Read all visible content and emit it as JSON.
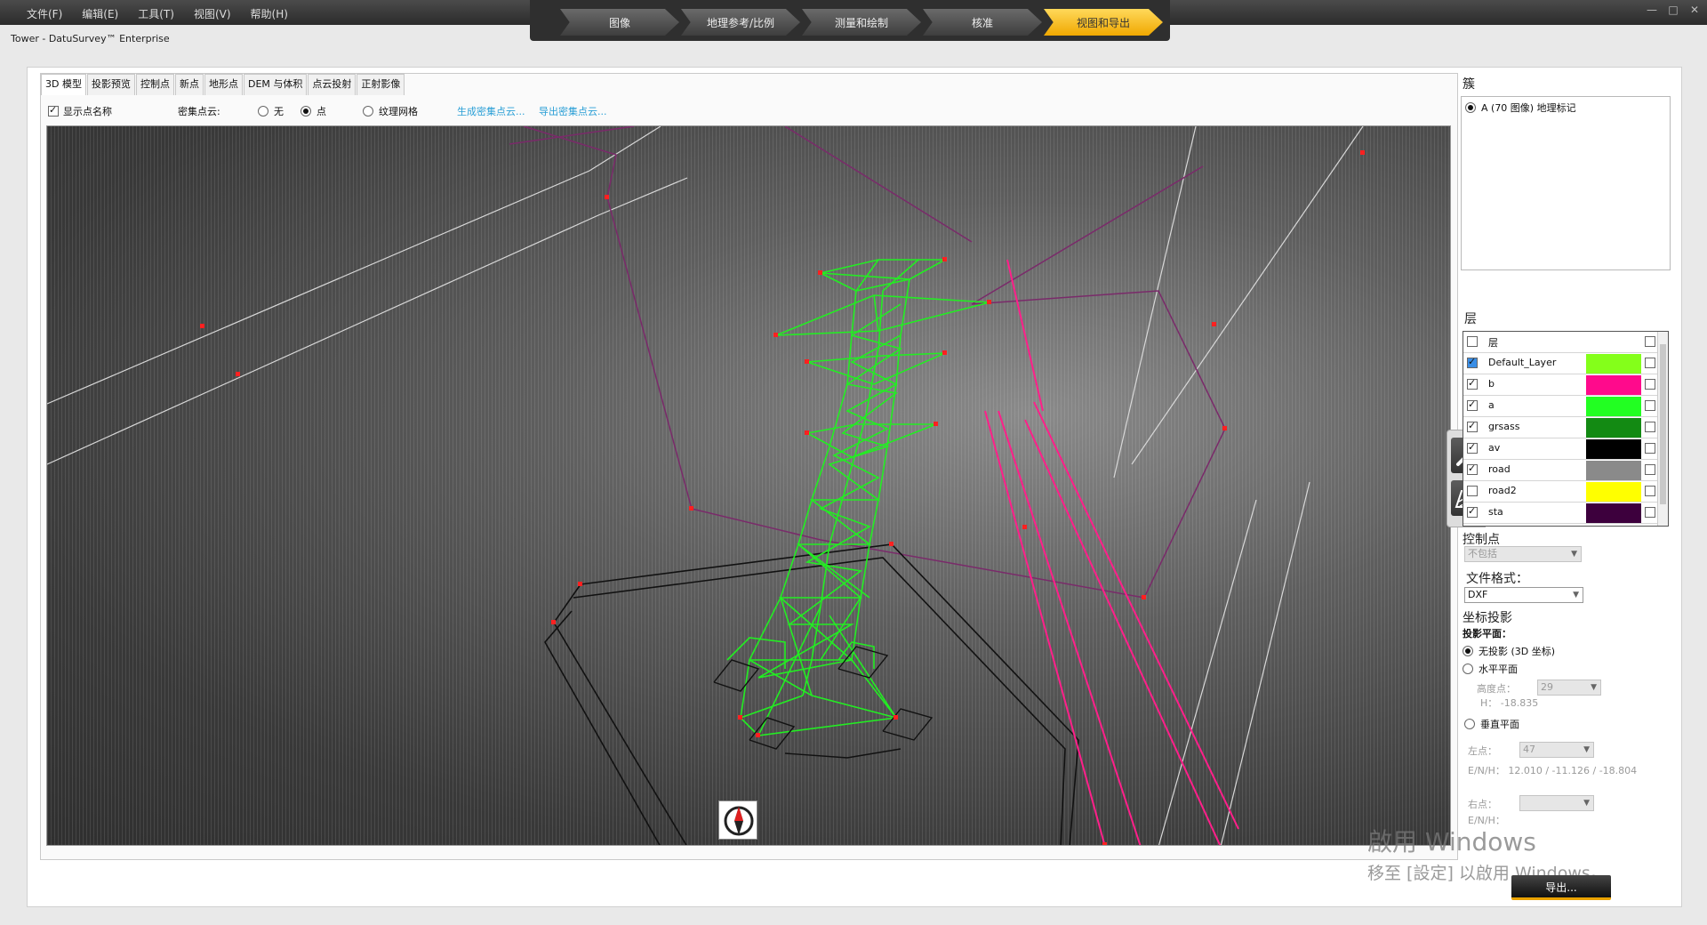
{
  "menu": [
    "文件(F)",
    "编辑(E)",
    "工具(T)",
    "视图(V)",
    "帮助(H)"
  ],
  "window_controls": [
    "—",
    "□",
    "✕"
  ],
  "app_title": "Tower - DatuSurvey™ Enterprise",
  "workflow_steps": [
    {
      "label": "图像",
      "active": false
    },
    {
      "label": "地理参考/比例",
      "active": false
    },
    {
      "label": "测量和绘制",
      "active": false
    },
    {
      "label": "核准",
      "active": false
    },
    {
      "label": "视图和导出",
      "active": true
    }
  ],
  "tabs": [
    "3D 模型",
    "投影预览",
    "控制点",
    "新点",
    "地形点",
    "DEM 与体积",
    "点云投射",
    "正射影像"
  ],
  "active_tab": 0,
  "options": {
    "show_point_names_label": "显示点名称",
    "show_point_names_checked": true,
    "dense_cloud_label": "密集点云:",
    "radio_none": "无",
    "radio_points": "点",
    "radio_texture": "纹理网格",
    "selected_mode": "点",
    "link_generate": "生成密集点云...",
    "link_export": "导出密集点云..."
  },
  "colors": {
    "tower": "#22ee22",
    "vertex": "#ff2020",
    "power_line": "#ff1f8a",
    "boundary": "#7a2a6a",
    "accent": "#f0a800"
  },
  "right": {
    "cluster_title": "簇",
    "cluster_item": "A (70 图像) 地理标记",
    "layers_title": "层",
    "layers_header": "层",
    "layers": [
      {
        "name": "Default_Layer",
        "checked": true,
        "color": "#84ff1a",
        "selected": true
      },
      {
        "name": "b",
        "checked": true,
        "color": "#ff0a8c",
        "selected": false
      },
      {
        "name": "a",
        "checked": true,
        "color": "#22ff22",
        "selected": false
      },
      {
        "name": "grsass",
        "checked": true,
        "color": "#138a13",
        "selected": false
      },
      {
        "name": "av",
        "checked": true,
        "color": "#000000",
        "selected": false
      },
      {
        "name": "road",
        "checked": true,
        "color": "#8a8a8a",
        "selected": false
      },
      {
        "name": "road2",
        "checked": false,
        "color": "#ffff00",
        "selected": false
      },
      {
        "name": "sta",
        "checked": true,
        "color": "#3d003d",
        "selected": false
      }
    ],
    "control_points_title": "控制点",
    "control_points_value": "不包括",
    "file_format_title": "文件格式：",
    "file_format_value": "DXF",
    "projection_title": "坐标投影",
    "projection_plane_label": "投影平面：",
    "opt_no_projection": "无投影 (3D 坐标)",
    "opt_horizontal": "水平平面",
    "height_point_label": "高度点：",
    "height_point_value": "29",
    "h_value": "H： -18.835",
    "opt_vertical": "垂直平面",
    "left_point_label": "左点：",
    "left_point_value": "47",
    "enh_value": "E/N/H： 12.010 / -11.126 / -18.804",
    "right_point_label": "右点：",
    "right_point_value": "",
    "enh_right_label": "E/N/H："
  },
  "export_button": "导出...",
  "watermark": {
    "line1": "啟用 Windows",
    "line2": "移至 [設定] 以啟用 Windows。"
  }
}
